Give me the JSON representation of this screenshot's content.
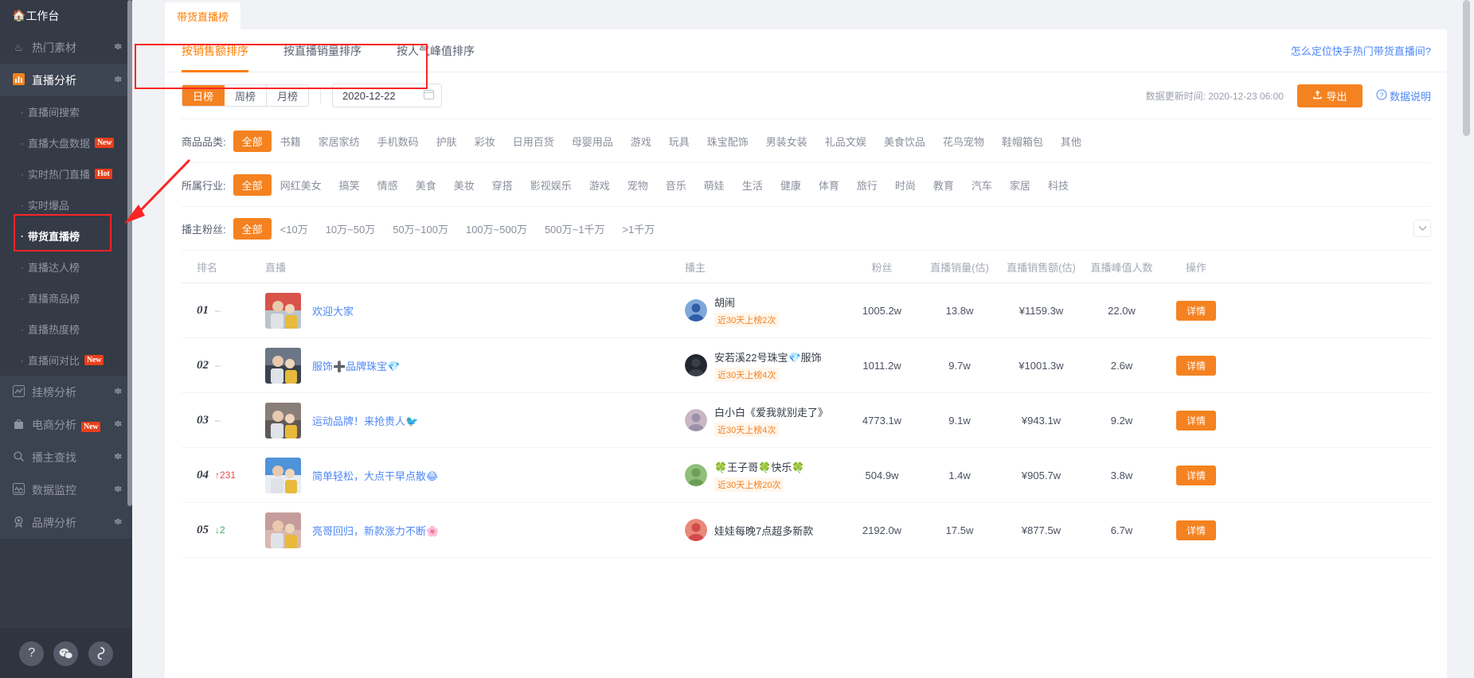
{
  "sidebar": {
    "top_item": {
      "label": "工作台",
      "icon": "home-icon"
    },
    "groups": [
      {
        "label": "热门素材",
        "icon": "fire-icon",
        "expanded": false
      },
      {
        "label": "直播分析",
        "icon": "bar-chart-icon",
        "expanded": true
      }
    ],
    "live_items": [
      {
        "label": "直播间搜索",
        "badge": ""
      },
      {
        "label": "直播大盘数据",
        "badge": "New"
      },
      {
        "label": "实时热门直播",
        "badge": "Hot"
      },
      {
        "label": "实时爆品",
        "badge": ""
      },
      {
        "label": "带货直播榜",
        "badge": "",
        "selected": true
      },
      {
        "label": "直播达人榜",
        "badge": ""
      },
      {
        "label": "直播商品榜",
        "badge": ""
      },
      {
        "label": "直播热度榜",
        "badge": ""
      },
      {
        "label": "直播间对比",
        "badge": "New"
      }
    ],
    "lower_groups": [
      {
        "label": "挂榜分析",
        "icon": "trend-icon",
        "badge": ""
      },
      {
        "label": "电商分析",
        "icon": "bag-icon",
        "badge": "New"
      },
      {
        "label": "播主查找",
        "icon": "search-icon",
        "badge": ""
      },
      {
        "label": "数据监控",
        "icon": "monitor-icon",
        "badge": ""
      },
      {
        "label": "品牌分析",
        "icon": "medal-icon",
        "badge": ""
      }
    ],
    "bottom_buttons": [
      {
        "name": "help-icon",
        "glyph": "?"
      },
      {
        "name": "wechat-icon",
        "glyph": "●●"
      },
      {
        "name": "link-icon",
        "glyph": "⚭"
      }
    ]
  },
  "tab": {
    "label": "带货直播榜"
  },
  "sort_tabs": [
    {
      "label": "按销售额排序",
      "active": true
    },
    {
      "label": "按直播销量排序",
      "active": false
    },
    {
      "label": "按人气峰值排序",
      "active": false
    }
  ],
  "help_link": "怎么定位快手热门带货直播间?",
  "controls": {
    "period_options": [
      {
        "label": "日榜",
        "active": true
      },
      {
        "label": "周榜",
        "active": false
      },
      {
        "label": "月榜",
        "active": false
      }
    ],
    "date_value": "2020-12-22",
    "update_text": "数据更新时间: 2020-12-23 06:00",
    "export_label": "导出",
    "export_icon": "upload-icon",
    "data_desc_label": "数据说明",
    "data_desc_icon": "question-circle-icon",
    "calendar_icon": "calendar-icon"
  },
  "filters": [
    {
      "label": "商品品类:",
      "options": [
        "全部",
        "书籍",
        "家居家纺",
        "手机数码",
        "护肤",
        "彩妆",
        "日用百货",
        "母婴用品",
        "游戏",
        "玩具",
        "珠宝配饰",
        "男装女装",
        "礼品文娱",
        "美食饮品",
        "花鸟宠物",
        "鞋帽箱包",
        "其他"
      ],
      "selected": "全部"
    },
    {
      "label": "所属行业:",
      "options": [
        "全部",
        "网红美女",
        "搞笑",
        "情感",
        "美食",
        "美妆",
        "穿搭",
        "影视娱乐",
        "游戏",
        "宠物",
        "音乐",
        "萌娃",
        "生活",
        "健康",
        "体育",
        "旅行",
        "时尚",
        "教育",
        "汽车",
        "家居",
        "科技"
      ],
      "selected": "全部"
    },
    {
      "label": "播主粉丝:",
      "options": [
        "全部",
        "<10万",
        "10万~50万",
        "50万~100万",
        "100万~500万",
        "500万~1千万",
        ">1千万"
      ],
      "selected": "全部",
      "collapsible": true
    }
  ],
  "table": {
    "headers": [
      "排名",
      "直播",
      "播主",
      "粉丝",
      "直播销量(估)",
      "直播销售额(估)",
      "直播峰值人数",
      "操作"
    ],
    "action_label": "详情",
    "rows": [
      {
        "rank": "01",
        "delta": "–",
        "delta_dir": "none",
        "live_title": "欢迎大家",
        "thumb_colors": [
          "#d8534a",
          "#b9c4cc"
        ],
        "host_name": "胡闹",
        "host_tag": "近30天上榜2次",
        "avatar_colors": [
          "#2f5ea8",
          "#7fa8d8"
        ],
        "fans": "1005.2w",
        "sales_volume": "13.8w",
        "sales_amount": "¥1159.3w",
        "peak_viewers": "22.0w"
      },
      {
        "rank": "02",
        "delta": "–",
        "delta_dir": "none",
        "live_title": "服饰➕品牌珠宝💎",
        "thumb_colors": [
          "#6b7686",
          "#3b424e"
        ],
        "host_name": "安若溪22号珠宝💎服饰",
        "host_tag": "近30天上榜4次",
        "avatar_colors": [
          "#3a3f4a",
          "#222730"
        ],
        "fans": "1011.2w",
        "sales_volume": "9.7w",
        "sales_amount": "¥1001.3w",
        "peak_viewers": "2.6w"
      },
      {
        "rank": "03",
        "delta": "–",
        "delta_dir": "none",
        "live_title": "运动品牌！来抢贵人🐦",
        "thumb_colors": [
          "#8a7f78",
          "#5f5a58"
        ],
        "host_name": "白小白《爱我就别走了》",
        "host_tag": "近30天上榜4次",
        "avatar_colors": [
          "#9c8fa8",
          "#c9b6c4"
        ],
        "fans": "4773.1w",
        "sales_volume": "9.1w",
        "sales_amount": "¥943.1w",
        "peak_viewers": "9.2w"
      },
      {
        "rank": "04",
        "delta": "231",
        "delta_dir": "up",
        "live_title": "简单轻松，大点干早点散😂",
        "thumb_colors": [
          "#4f93d9",
          "#e8edf2"
        ],
        "host_name": "🍀王子哥🍀快乐🍀",
        "host_tag": "近30天上榜20次",
        "avatar_colors": [
          "#6b9e57",
          "#8fbf7a"
        ],
        "fans": "504.9w",
        "sales_volume": "1.4w",
        "sales_amount": "¥905.7w",
        "peak_viewers": "3.8w"
      },
      {
        "rank": "05",
        "delta": "2",
        "delta_dir": "down",
        "live_title": "亮哥回归，新款涨力不断🌸",
        "thumb_colors": [
          "#c59c9c",
          "#d9b8b0"
        ],
        "host_name": "娃娃每晚7点超多新款",
        "host_tag": "",
        "avatar_colors": [
          "#d24a4a",
          "#e8887a"
        ],
        "fans": "2192.0w",
        "sales_volume": "17.5w",
        "sales_amount": "¥877.5w",
        "peak_viewers": "6.7w"
      }
    ]
  }
}
